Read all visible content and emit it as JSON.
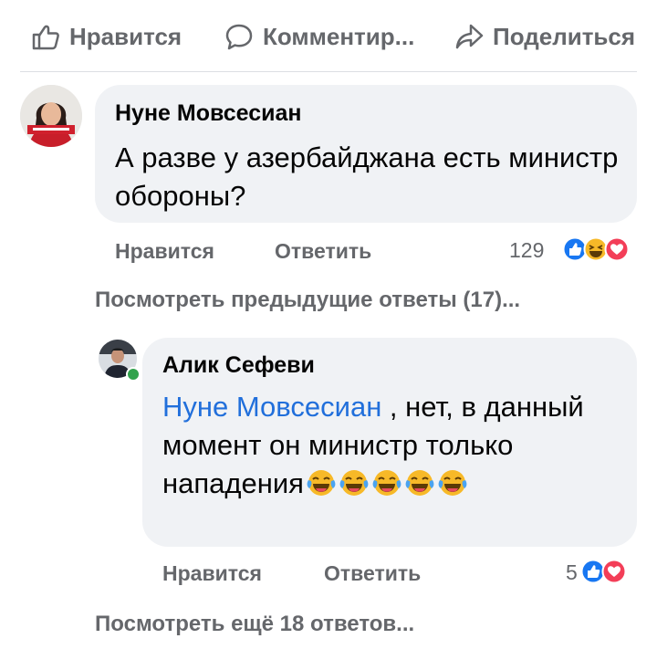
{
  "action_bar": {
    "like_label": "Нравится",
    "comment_label": "Комментир...",
    "share_label": "Поделиться"
  },
  "comments": [
    {
      "author": "Нуне Мовсесиан",
      "text": "А разве у азербайджана есть министр обороны?",
      "like_label": "Нравится",
      "reply_label": "Ответить",
      "reaction_count": "129",
      "reaction_icons": [
        "like-reaction-icon",
        "haha-reaction-icon",
        "love-reaction-icon"
      ]
    },
    {
      "author": "Алик Сефеви",
      "mention": "Нуне Мовсесиан",
      "text": " , нет, в данный момент он министр только  нападения",
      "emoji_count": 5,
      "like_label": "Нравится",
      "reply_label": "Ответить",
      "reaction_count": "5",
      "reaction_icons": [
        "like-reaction-icon",
        "love-reaction-icon"
      ]
    }
  ],
  "links": {
    "previous_replies": "Посмотреть предыдущие ответы (17)...",
    "more_replies": "Посмотреть ещё 18 ответов..."
  },
  "colors": {
    "muted": "#65676b",
    "mention": "#216fdb",
    "bubble": "#f0f2f5",
    "like": "#1877f2",
    "love": "#f33e58",
    "haha": "#f7b928"
  }
}
